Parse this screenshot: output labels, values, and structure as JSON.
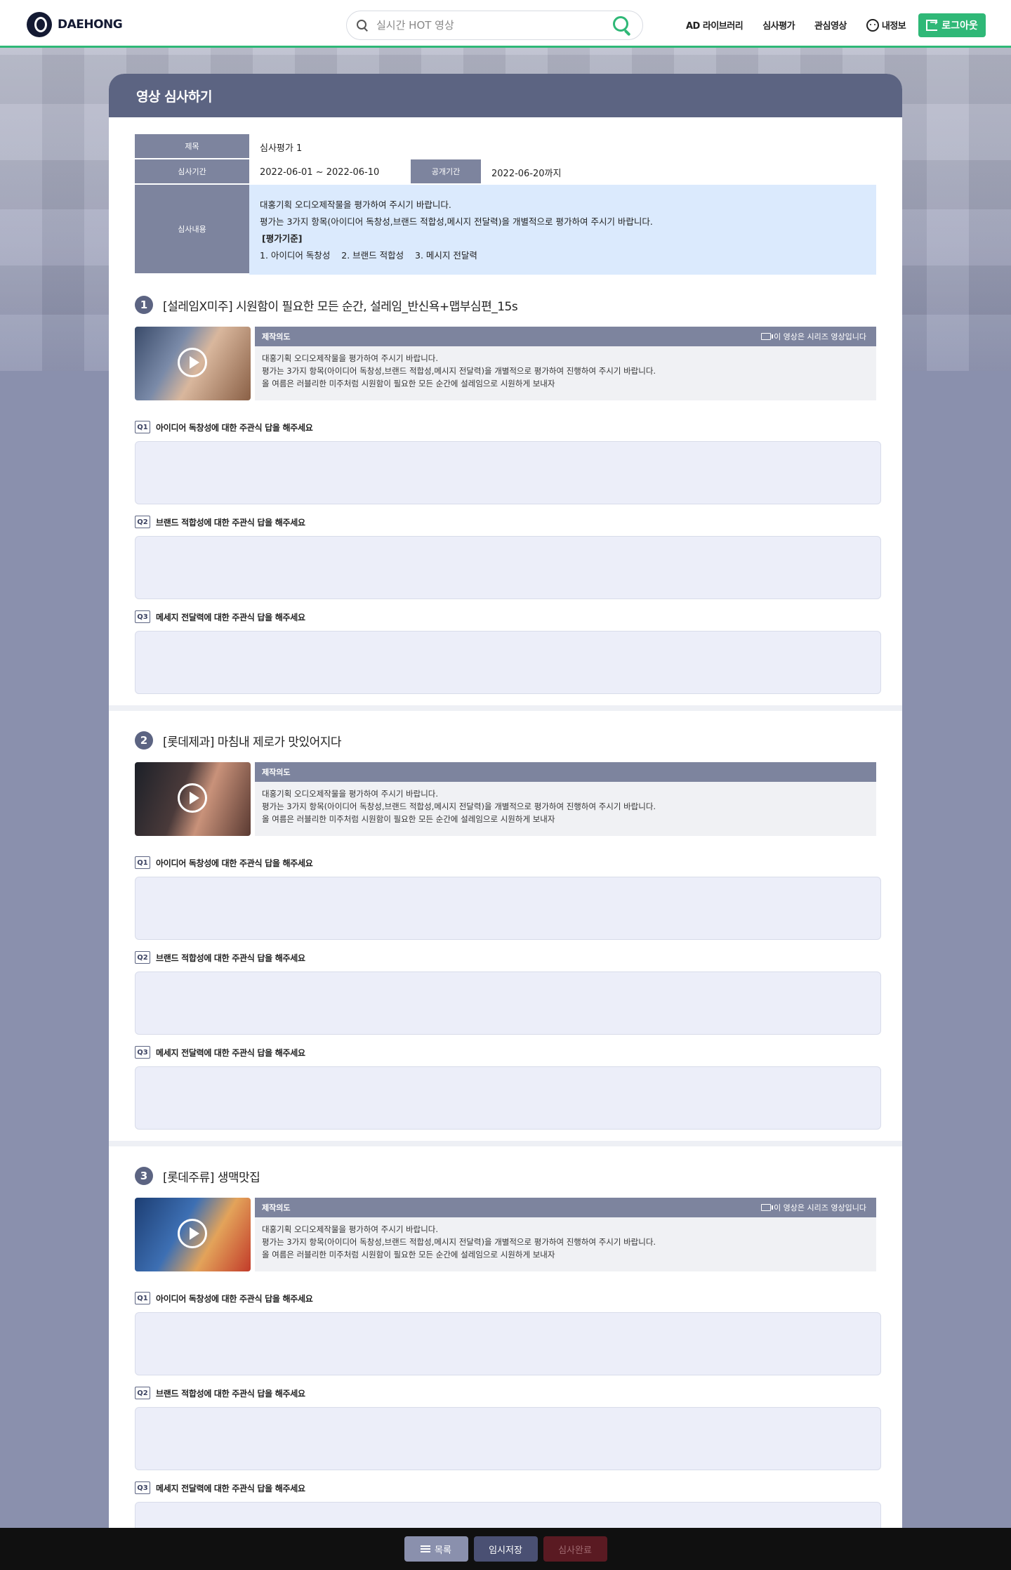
{
  "header": {
    "logo_text": "DAEHONG",
    "search_placeholder": "실시간 HOT 영상",
    "nav": [
      "AD 라이브러리",
      "심사평가",
      "관심영상",
      "내정보"
    ],
    "logout_label": "로그아웃",
    "accent_color": "#2fb877"
  },
  "panel": {
    "title": "영상 심사하기",
    "info": {
      "title_label": "제목",
      "title_value": "심사평가 1",
      "period_label": "심사기간",
      "period_value": "2022-06-01 ~ 2022-06-10",
      "open_label": "공개기간",
      "open_value": "2022-06-20까지",
      "content_label": "심사내용",
      "content_line1": "대홍기획 오디오제작물을 평가하여 주시기 바랍니다.",
      "content_line2": "평가는 3가지 항목(아이디어 독창성,브랜드 적합성,메시지 전달력)을 개별적으로 평가하여 주시기 바랍니다.",
      "criteria_title": "[평가기준]",
      "criteria": "1. 아이디어 독창성    2. 브랜드 적합성    3. 메시지 전달력"
    }
  },
  "videos": [
    {
      "num": "1",
      "title": "[설레임X미주] 시원함이 필요한 모든 순간, 설레임_반신욕+맵부심편_15s",
      "intent_label": "제작의도",
      "series_note": "이 영상은 시리즈 영상입니다",
      "intent_lines": [
        "대홍기획 오디오제작물을 평가하여 주시기 바랍니다.",
        "평가는 3가지 항목(아이디어 독창성,브랜드 적합성,메시지 전달력)을 개별적으로 평가하여 진행하여 주시기 바랍니다.",
        "올 여름은 러블리한 미주처럼  시원함이 필요한 모든 순간에 설레임으로 시원하게 보내자"
      ]
    },
    {
      "num": "2",
      "title": "[롯데제과] 마침내 제로가 맛있어지다",
      "intent_label": "제작의도",
      "series_note": "",
      "intent_lines": [
        "대홍기획 오디오제작물을 평가하여 주시기 바랍니다.",
        "평가는 3가지 항목(아이디어 독창성,브랜드 적합성,메시지 전달력)을 개별적으로 평가하여 진행하여 주시기 바랍니다.",
        "올 여름은 러블리한 미주처럼  시원함이 필요한 모든 순간에 설레임으로 시원하게 보내자"
      ]
    },
    {
      "num": "3",
      "title": "[롯데주류] 생맥맛집",
      "intent_label": "제작의도",
      "series_note": "이 영상은 시리즈 영상입니다",
      "intent_lines": [
        "대홍기획 오디오제작물을 평가하여 주시기 바랍니다.",
        "평가는 3가지 항목(아이디어 독창성,브랜드 적합성,메시지 전달력)을 개별적으로 평가하여 진행하여 주시기 바랍니다.",
        "올 여름은 러블리한 미주처럼  시원함이 필요한 모든 순간에 설레임으로 시원하게 보내자"
      ]
    }
  ],
  "questions": [
    {
      "badge": "Q1",
      "text": "아이디어 독창성에 대한 주관식 답을 해주세요"
    },
    {
      "badge": "Q2",
      "text": "브랜드 적합성에 대한 주관식 답을 해주세요"
    },
    {
      "badge": "Q3",
      "text": "메세지 전달력에 대한 주관식 답을 해주세요"
    }
  ],
  "footer": {
    "list_label": "목록",
    "save_label": "임시저장",
    "done_label": "심사완료"
  }
}
